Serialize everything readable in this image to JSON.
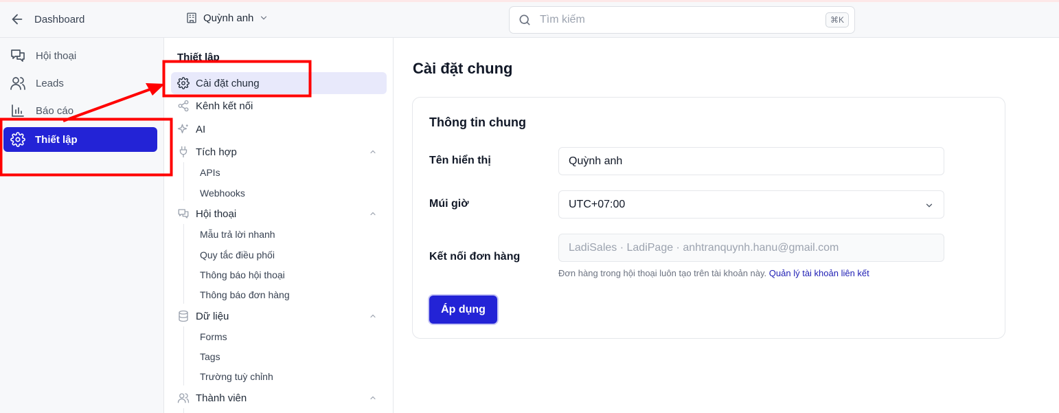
{
  "topbar": {
    "back_label": "Dashboard",
    "workspace_name": "Quỳnh anh",
    "search_placeholder": "Tìm kiếm",
    "search_shortcut": "⌘K"
  },
  "leftnav": {
    "items": [
      {
        "label": "Hội thoại",
        "icon": "chat-icon"
      },
      {
        "label": "Leads",
        "icon": "users-icon"
      },
      {
        "label": "Báo cáo",
        "icon": "chart-icon"
      },
      {
        "label": "Thiết lập",
        "icon": "gear-icon",
        "active": true
      }
    ]
  },
  "subnav": {
    "title": "Thiết lập",
    "items": [
      {
        "label": "Cài đặt chung",
        "icon": "gear-icon",
        "active": true
      },
      {
        "label": "Kênh kết nối",
        "icon": "share-icon"
      },
      {
        "label": "AI",
        "icon": "sparkle-icon"
      },
      {
        "label": "Tích hợp",
        "icon": "plug-icon",
        "expanded": true,
        "children": [
          "APIs",
          "Webhooks"
        ]
      },
      {
        "label": "Hội thoại",
        "icon": "chat-icon",
        "expanded": true,
        "children": [
          "Mẫu trả lời nhanh",
          "Quy tắc điều phối",
          "Thông báo hội thoại",
          "Thông báo đơn hàng"
        ]
      },
      {
        "label": "Dữ liệu",
        "icon": "database-icon",
        "expanded": true,
        "children": [
          "Forms",
          "Tags",
          "Trường tuỳ chỉnh"
        ]
      },
      {
        "label": "Thành viên",
        "icon": "users-icon",
        "expanded": true
      }
    ]
  },
  "main": {
    "title": "Cài đặt chung",
    "card": {
      "title": "Thông tin chung",
      "display_name_label": "Tên hiển thị",
      "display_name_value": "Quỳnh anh",
      "timezone_label": "Múi giờ",
      "timezone_value": "UTC+07:00",
      "order_link_label": "Kết nối đơn hàng",
      "order_link_value": "LadiSales · LadiPage · anhtranquynh.hanu@gmail.com",
      "hint_text": "Đơn hàng trong hội thoại luôn tạo trên tài khoản này.",
      "hint_link": "Quản lý tài khoản liên kết",
      "apply_label": "Áp dụng"
    }
  },
  "colors": {
    "accent": "#2323d6",
    "annotation": "#ff0000"
  }
}
